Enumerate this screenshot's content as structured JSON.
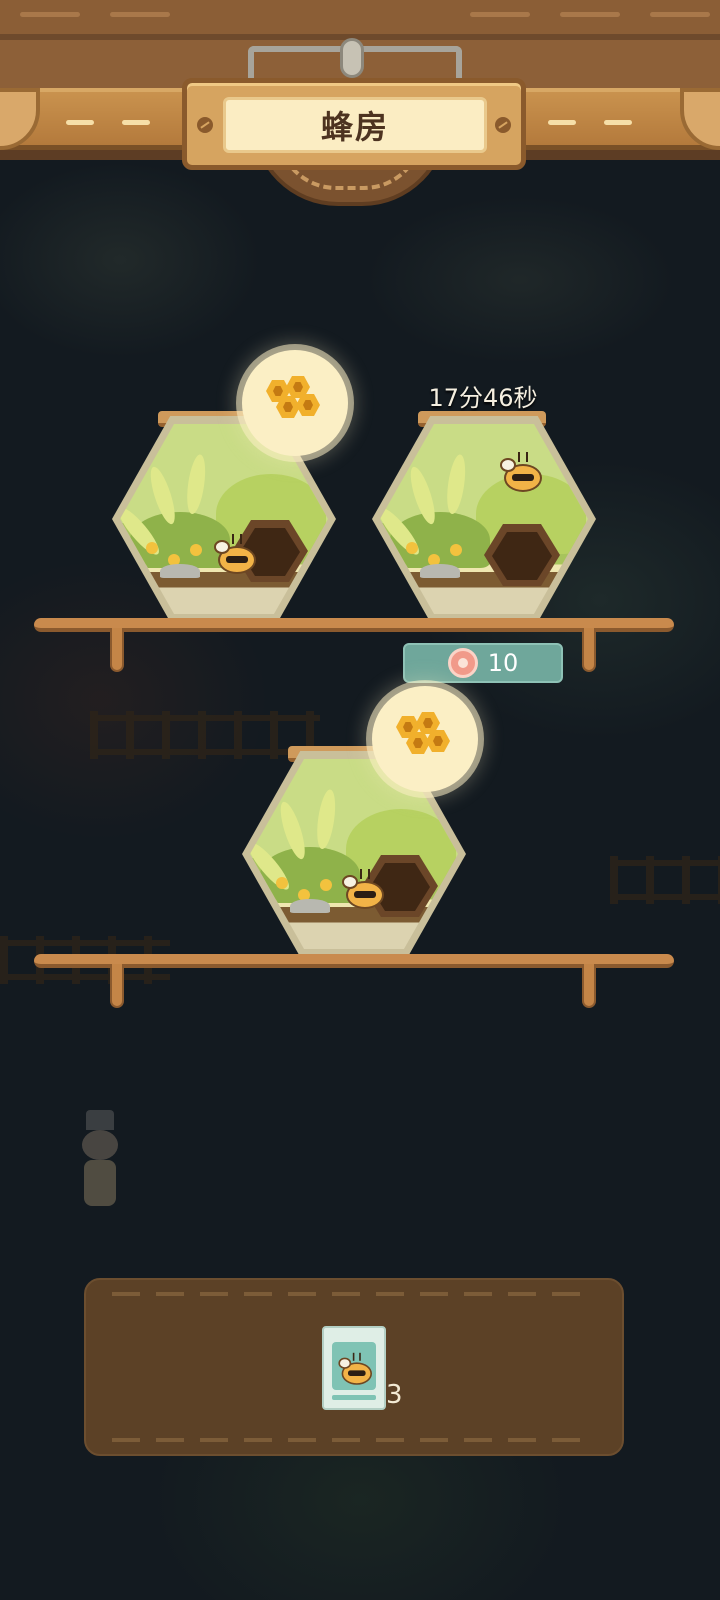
{
  "header": {
    "title": "蜂房"
  },
  "hives": [
    {
      "status": "honey_ready",
      "honey_icon": "honeycomb-icon"
    },
    {
      "status": "producing",
      "timer": "17分46秒",
      "speed_up": {
        "cost_icon": "flower-coin-icon",
        "cost": "10"
      }
    },
    {
      "status": "honey_ready",
      "honey_icon": "honeycomb-icon"
    }
  ],
  "inventory": {
    "items": [
      {
        "icon": "bee-seed-pack-icon",
        "count": "3"
      }
    ]
  },
  "colors": {
    "wood": "#c98a4d",
    "title_plate": "#fbedc3",
    "honey": "#f1b02c",
    "speed_up_button": "#6fa79b",
    "panel": "#5c4126"
  }
}
